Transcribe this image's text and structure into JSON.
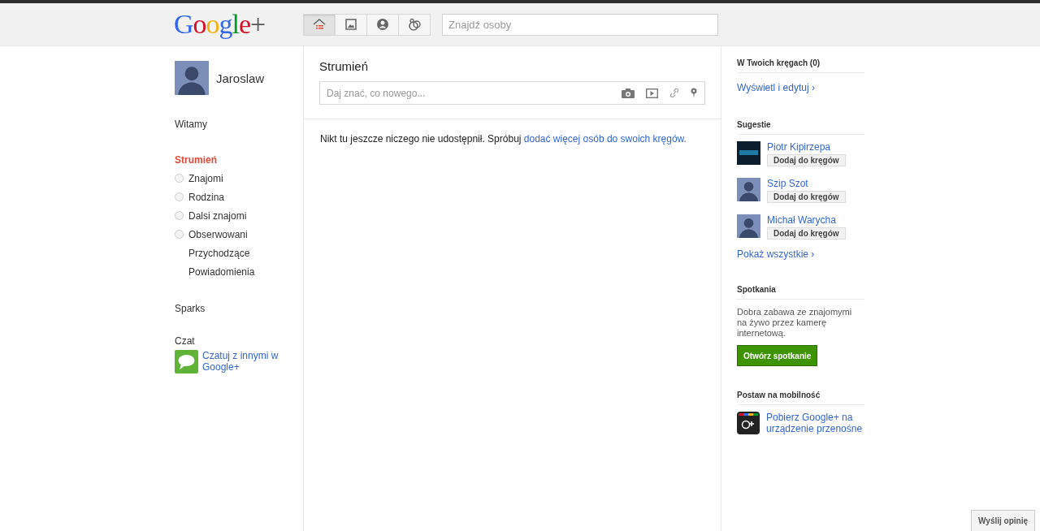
{
  "header": {
    "logo": "Google+",
    "nav": [
      {
        "kind": "home",
        "selected": true
      },
      {
        "kind": "photos",
        "selected": false
      },
      {
        "kind": "profile",
        "selected": false
      },
      {
        "kind": "circles",
        "selected": false
      }
    ],
    "search": {
      "placeholder": "Znajdź osoby"
    }
  },
  "sidebar": {
    "user": "Jaroslaw",
    "welcome": {
      "label": "Witamy",
      "selected": false
    },
    "stream": [
      {
        "label": "Strumień",
        "kind": "heading",
        "selected": true
      },
      {
        "label": "Znajomi",
        "kind": "circle",
        "selected": false
      },
      {
        "label": "Rodzina",
        "kind": "circle",
        "selected": false
      },
      {
        "label": "Dalsi znajomi",
        "kind": "circle",
        "selected": false
      },
      {
        "label": "Obserwowani",
        "kind": "circle",
        "selected": false
      },
      {
        "label": "Przychodzące",
        "kind": "plain",
        "selected": false
      },
      {
        "label": "Powiadomienia",
        "kind": "plain",
        "selected": false
      }
    ],
    "sparks": {
      "label": "Sparks",
      "selected": false
    },
    "chat": {
      "title": "Czat",
      "link": "Czatuj z innymi w Google+"
    }
  },
  "main": {
    "title": "Strumień",
    "share": {
      "placeholder": "Daj znać, co nowego...",
      "tools": [
        {
          "kind": "camera"
        },
        {
          "kind": "video"
        },
        {
          "kind": "link"
        },
        {
          "kind": "pin"
        }
      ]
    },
    "empty_text": "Nikt tu jeszcze niczego nie udostępnił. Spróbuj",
    "empty_link": "dodać więcej osób do swoich kręgów."
  },
  "right": {
    "circles": {
      "title": "W Twoich kręgach (0)",
      "link": "Wyświetl i edytuj ›"
    },
    "suggestions": {
      "title": "Sugestie",
      "people": [
        {
          "name": "Piotr Kipirzepa",
          "kind": "photo",
          "button": "Dodaj do kręgów"
        },
        {
          "name": "Szip Szot",
          "kind": "silhouette",
          "button": "Dodaj do kręgów"
        },
        {
          "name": "Michał Warycha",
          "kind": "silhouette",
          "button": "Dodaj do kręgów"
        }
      ],
      "more": "Pokaż wszystkie ›"
    },
    "hangouts": {
      "title": "Spotkania",
      "text": "Dobra zabawa ze znajomymi na żywo przez kamerę internetową.",
      "button": "Otwórz spotkanie"
    },
    "mobile": {
      "title": "Postaw na mobilność",
      "link": "Pobierz Google+ na urządzenie przenośne"
    }
  },
  "feedback": "Wyślij opinię"
}
